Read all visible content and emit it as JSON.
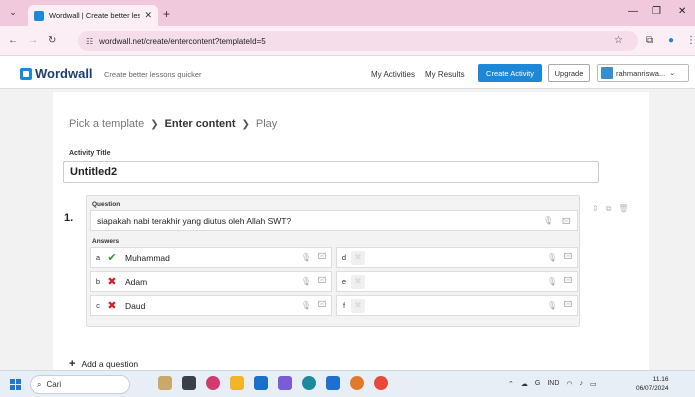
{
  "browser": {
    "tab_title": "Wordwall | Create better lesson",
    "url": "wordwall.net/create/entercontent?templateId=5"
  },
  "header": {
    "brand": "Wordwall",
    "tagline": "Create better lessons quicker",
    "nav_activities": "My Activities",
    "nav_results": "My Results",
    "create_label": "Create Activity",
    "upgrade_label": "Upgrade",
    "user_name": "rahmanriswa..."
  },
  "breadcrumb": {
    "step1": "Pick a template",
    "step2": "Enter content",
    "step3": "Play"
  },
  "activity": {
    "title_label": "Activity Title",
    "title_value": "Untitled2"
  },
  "question": {
    "number": "1.",
    "label": "Question",
    "text": "siapakah nabi terakhir yang diutus oleh Allah SWT?",
    "answers_label": "Answers",
    "answers": [
      {
        "letter": "a",
        "text": "Muhammad",
        "status": "correct"
      },
      {
        "letter": "b",
        "text": "Adam",
        "status": "wrong"
      },
      {
        "letter": "c",
        "text": "Daud",
        "status": "wrong"
      },
      {
        "letter": "d",
        "text": "",
        "status": "empty"
      },
      {
        "letter": "e",
        "text": "",
        "status": "empty"
      },
      {
        "letter": "f",
        "text": "",
        "status": "empty"
      }
    ]
  },
  "add_question_label": "Add a question",
  "taskbar": {
    "search_label": "Cari",
    "lang": "IND",
    "time": "11.16",
    "date": "06/07/2024"
  },
  "colors": {
    "accent": "#1e88d8",
    "correct": "#2e9b3a",
    "wrong": "#d9202c"
  }
}
